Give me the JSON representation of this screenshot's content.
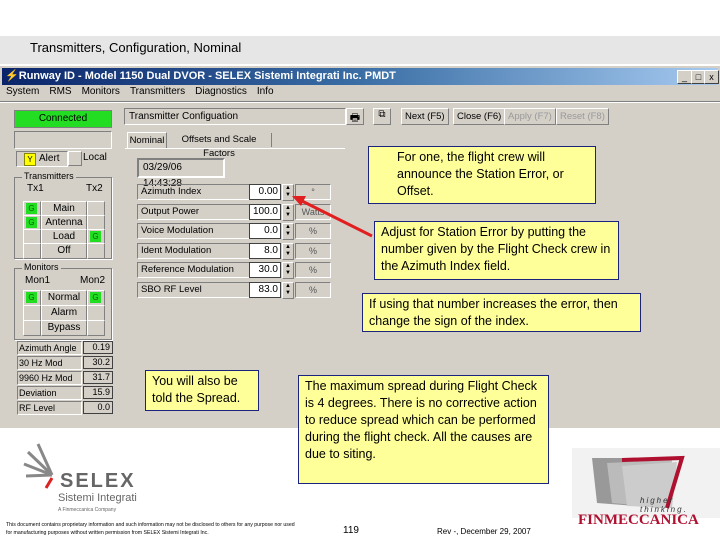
{
  "slide": {
    "title": "Transmitters, Configuration, Nominal",
    "page": "119",
    "rev": "Rev -, December 29, 2007",
    "disclaimer": "This document contains proprietary information and such information may not be disclosed to others for any purpose nor used for manufacturing purposes without written permission from SELEX Sistemi Integrati Inc."
  },
  "window": {
    "title": "Runway ID - Model 1150 Dual DVOR - SELEX Sistemi Integrati Inc. PMDT",
    "controls": [
      "_",
      "□",
      "x"
    ]
  },
  "menu": [
    "System",
    "RMS",
    "Monitors",
    "Transmitters",
    "Diagnostics",
    "Info"
  ],
  "left": {
    "status": "Connected",
    "alert": "Alert",
    "alert_flag": "Y",
    "local": "Local",
    "transmitters": {
      "title": "Transmitters",
      "tx1": "Tx1",
      "tx2": "Tx2",
      "rows": [
        {
          "label": "Main",
          "tx1": "G",
          "tx2": ""
        },
        {
          "label": "Antenna",
          "tx1": "G",
          "tx2": ""
        },
        {
          "label": "Load",
          "tx1": "",
          "tx2": "G"
        },
        {
          "label": "Off",
          "tx1": "",
          "tx2": ""
        }
      ]
    },
    "monitors": {
      "title": "Monitors",
      "mon1": "Mon1",
      "mon2": "Mon2",
      "rows": [
        {
          "label": "Normal",
          "m1": "G",
          "m2": "G"
        },
        {
          "label": "Alarm",
          "m1": "",
          "m2": ""
        },
        {
          "label": "Bypass",
          "m1": "",
          "m2": ""
        }
      ]
    },
    "readouts": [
      {
        "label": "Azimuth Angle",
        "value": "0.19"
      },
      {
        "label": "30 Hz Mod",
        "value": "30.2"
      },
      {
        "label": "9960 Hz Mod",
        "value": "31.7"
      },
      {
        "label": "Deviation",
        "value": "15.9"
      },
      {
        "label": "RF Level",
        "value": "0.0"
      }
    ]
  },
  "config": {
    "title": "Transmitter Configuation",
    "buttons": [
      "Next (F5)",
      "Close (F6)",
      "Apply (F7)",
      "Reset (F8)"
    ],
    "tabs": [
      "Nominal",
      "Offsets and Scale Factors"
    ],
    "timestamp": "03/29/06 14:43:28",
    "rows": [
      {
        "label": "Azimuth Index",
        "value": "0.00",
        "unit": "°"
      },
      {
        "label": "Output Power",
        "value": "100.0",
        "unit": "Watts"
      },
      {
        "label": "Voice Modulation",
        "value": "0.0",
        "unit": "%"
      },
      {
        "label": "Ident Modulation",
        "value": "8.0",
        "unit": "%"
      },
      {
        "label": "Reference Modulation",
        "value": "30.0",
        "unit": "%"
      },
      {
        "label": "SBO RF Level",
        "value": "83.0",
        "unit": "%"
      }
    ]
  },
  "callouts": [
    "For one, the flight crew will announce the Station Error, or Offset.",
    "Adjust for Station Error by putting the number given by the Flight Check crew in the Azimuth Index field.",
    "If using that number increases the error, then change the sign of the index.",
    "You will also be told the Spread.",
    "The maximum spread during Flight Check is 4 degrees.  There is no corrective action to reduce spread which can be performed during the flight check.  All the causes are due to siting."
  ],
  "logos": {
    "selex": "SELEX",
    "selex_sub": "Sistemi Integrati",
    "selex_tag": "A Finmeccanica Company",
    "finmeccanica": "FINMECCANICA",
    "finmeccanica_tag": "higher thinking."
  },
  "colors": {
    "connected": "#22dd22",
    "callout": "#ffff99",
    "arrow": "#e02020"
  }
}
